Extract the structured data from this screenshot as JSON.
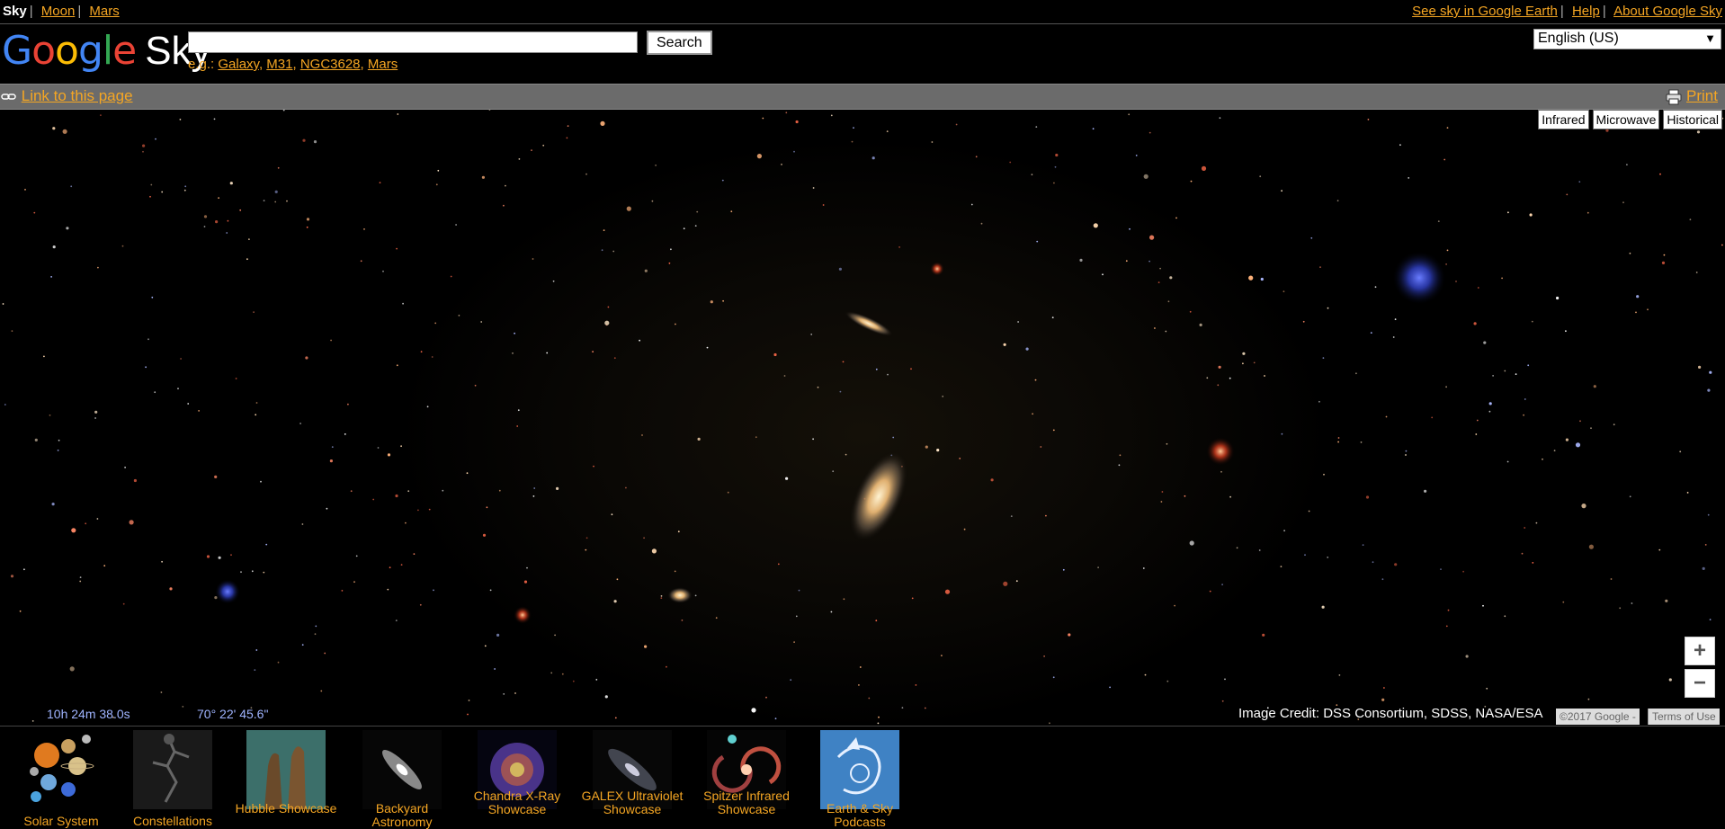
{
  "topnav": {
    "left": [
      {
        "label": "Sky",
        "current": true
      },
      {
        "label": "Moon"
      },
      {
        "label": "Mars"
      }
    ],
    "right": [
      "See sky in Google Earth",
      "Help",
      "About Google Sky"
    ]
  },
  "header": {
    "logo_text": "Google",
    "logo_suffix": "Sky",
    "search_value": "",
    "search_button": "Search",
    "examples_prefix": "e.g.:",
    "examples": [
      "Galaxy",
      "M31",
      "NGC3628",
      "Mars"
    ],
    "language": "English (US)"
  },
  "linkbar": {
    "link_label": "Link to this page",
    "print_label": "Print"
  },
  "map": {
    "layers": [
      "Infrared",
      "Microwave",
      "Historical"
    ],
    "ra": "10h 24m 38.0s",
    "dec": "70° 22' 45.6\"",
    "credit": "Image Credit: DSS Consortium, SDSS, NASA/ESA",
    "copyright": "©2017 Google -",
    "terms": "Terms of Use",
    "zoom_in": "+",
    "zoom_out": "−"
  },
  "showcases": [
    {
      "label": "Solar System"
    },
    {
      "label": "Constellations"
    },
    {
      "label": "Hubble Showcase"
    },
    {
      "label": "Backyard Astronomy"
    },
    {
      "label": "Chandra X-Ray Showcase"
    },
    {
      "label": "GALEX Ultraviolet Showcase"
    },
    {
      "label": "Spitzer Infrared Showcase"
    },
    {
      "label": "Earth & Sky Podcasts"
    }
  ],
  "colors": {
    "link": "#f5a623",
    "background": "#000000",
    "bar": "#6b6b6b"
  }
}
